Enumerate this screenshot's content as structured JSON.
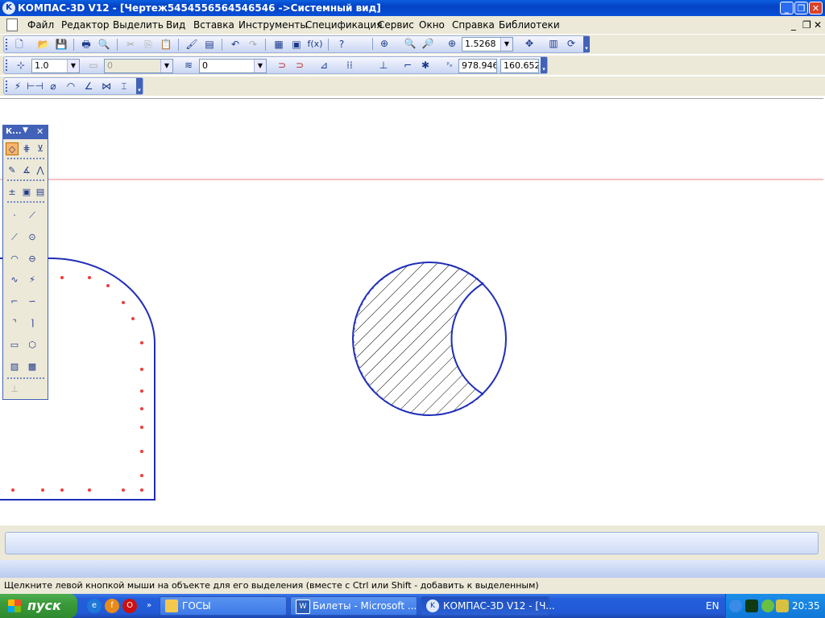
{
  "window": {
    "title": "КОМПАС-3D V12 - [Чертеж5454556564546546 ->Системный вид]",
    "app_icon": "kompas-logo-icon",
    "controls": {
      "minimize": "_",
      "restore": "❐",
      "close": "✕"
    }
  },
  "menu": {
    "items": [
      "Файл",
      "Редактор",
      "Выделить",
      "Вид",
      "Вставка",
      "Инструменты",
      "Спецификация",
      "Сервис",
      "Окно",
      "Справка",
      "Библиотеки"
    ],
    "mdi_controls": {
      "minimize": "_",
      "restore": "❐",
      "close": "✕"
    }
  },
  "toolbar_standard": {
    "buttons": [
      "new-document",
      "open",
      "save",
      "print",
      "print-preview",
      "cut",
      "copy",
      "paste",
      "format-painter",
      "properties",
      "undo",
      "redo",
      "manager",
      "library-manager",
      "variables",
      "help-pointer"
    ],
    "variables_label": "f(x)",
    "zoom_value": "1.5268"
  },
  "toolbar_current_state": {
    "step_value": "1.0",
    "layer_value": "0",
    "style_value": "0",
    "coord_x": "978.946",
    "coord_y": "160.652"
  },
  "compact_panel": {
    "title": "К..."
  },
  "status": {
    "hint": "Щелкните левой кнопкой мыши на объекте для его выделения (вместе с Ctrl или Shift - добавить к выделенным)"
  },
  "taskbar": {
    "start_label": "пуск",
    "tasks": [
      {
        "label": "ГОСЫ",
        "icon": "folder-icon"
      },
      {
        "label": "Билеты - Microsoft ...",
        "icon": "word-icon"
      },
      {
        "label": "КОМПАС-3D V12 - [Ч...",
        "icon": "kompas-icon"
      }
    ],
    "language": "EN",
    "clock": "20:35"
  },
  "colors": {
    "drawing_line": "#1f2db8",
    "axis_line": "#f08080",
    "points": "#f03c3c",
    "xp_blue": "#245edb",
    "start_green": "#3a9a3a"
  }
}
